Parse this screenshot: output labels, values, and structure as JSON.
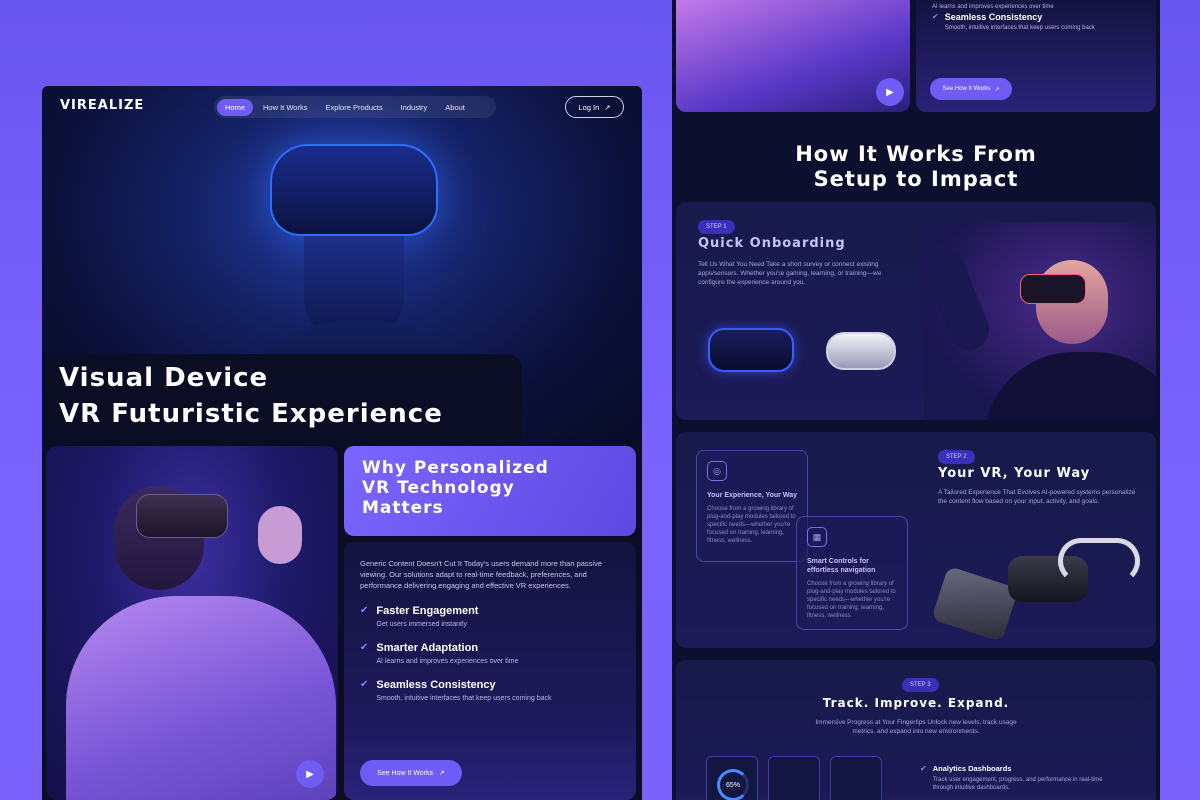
{
  "nav": {
    "logo": "VIREALIZE",
    "items": [
      "Home",
      "How It Works",
      "Explore Products",
      "Industry",
      "About"
    ],
    "login": "Log In"
  },
  "hero": {
    "title_line1": "Visual Device",
    "title_line2": "VR Futuristic Experience"
  },
  "why": {
    "title_line1": "Why Personalized",
    "title_line2": "VR Technology",
    "title_line3": "Matters",
    "text": "Generic Content Doesn't Cut It Today's users demand more than passive viewing. Our solutions adapt to real-time feedback, preferences, and performance delivering engaging and effective VR experiences.",
    "features": [
      {
        "title": "Faster Engagement",
        "desc": "Get users immersed instantly"
      },
      {
        "title": "Smarter Adaptation",
        "desc": "AI learns and improves experiences over time"
      },
      {
        "title": "Seamless Consistency",
        "desc": "Smooth, intuitive interfaces that keep users coming back"
      }
    ],
    "button": "See How It Works"
  },
  "right_top": {
    "prev_desc": "AI learns and improves experiences over time",
    "feature_title": "Seamless Consistency",
    "feature_desc": "Smooth, intuitive interfaces that keep users coming back",
    "button": "See How It Works"
  },
  "how": {
    "title_line1": "How It Works From",
    "title_line2": "Setup to Impact"
  },
  "step1": {
    "tag": "STEP 1",
    "title": "Quick Onboarding",
    "text": "Tell Us What You Need Take a short survey or connect existing apps/sensors. Whether you're gaming, learning, or training—we configure the experience around you."
  },
  "step2": {
    "tag": "STEP 2",
    "title": "Your VR, Your Way",
    "text": "A Tailored Experience That Evolves AI-powered systems personalize the content flow based on your input, activity, and goals.",
    "card1_title": "Your Experience, Your Way",
    "card1_desc": "Choose from a growing library of plug-and-play modules tailored to specific needs—whether you're focused on training, learning, fitness, wellness.",
    "card2_title": "Smart Controls for effortless navigation",
    "card2_desc": "Choose from a growing library of plug-and-play modules tailored to specific needs—whether you're focused on training, learning, fitness, wellness."
  },
  "step3": {
    "tag": "STEP 3",
    "title": "Track. Improve. Expand.",
    "text": "Immersive Progress at Your Fingertips Unlock new levels, track usage metrics, and expand into new environments.",
    "dash_value": "65%",
    "analytics_title": "Analytics Dashboards",
    "analytics_desc": "Track user engagement, progress, and performance in real-time through intuitive dashboards."
  },
  "colors": {
    "accent": "#6e5cf5",
    "background": "#7b63ff",
    "card": "#0a0d24"
  }
}
